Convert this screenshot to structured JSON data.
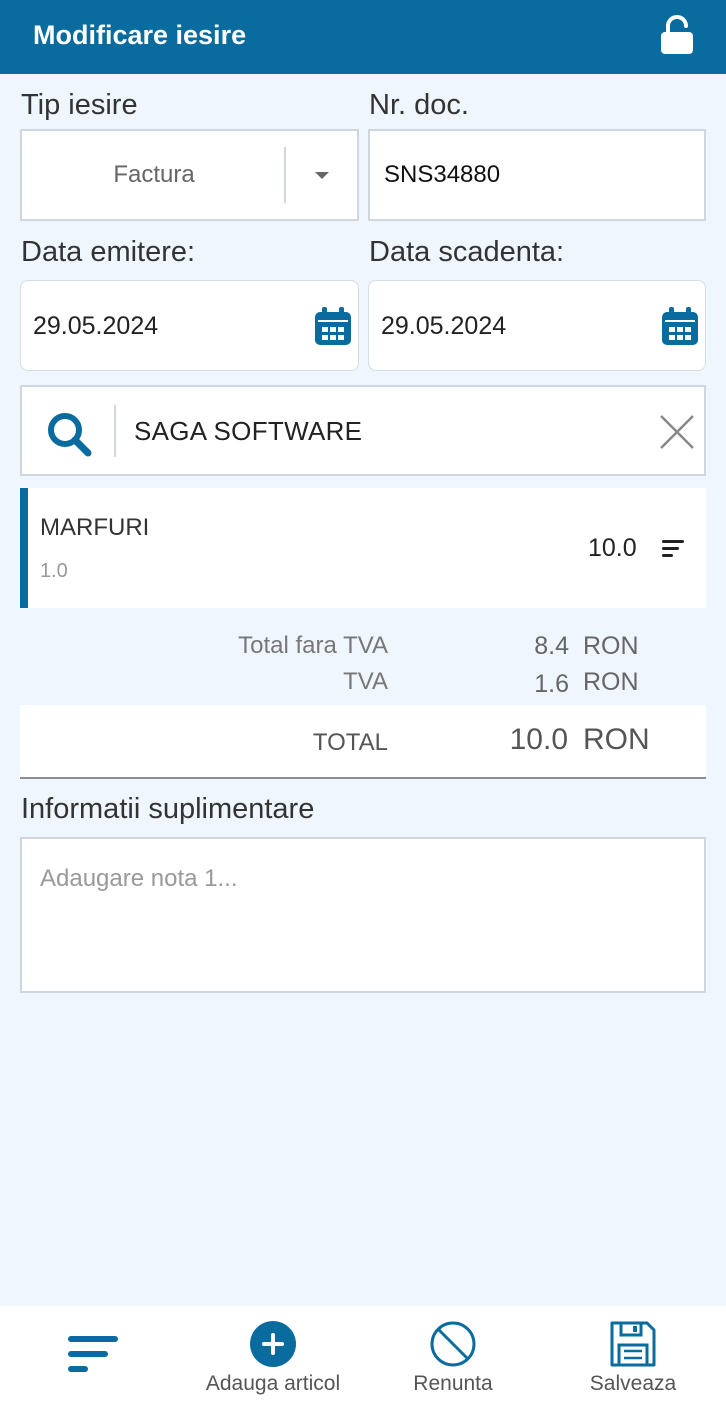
{
  "header": {
    "title": "Modificare iesire"
  },
  "form": {
    "tip_iesire_label": "Tip iesire",
    "tip_iesire_value": "Factura",
    "nr_doc_label": "Nr. doc.",
    "nr_doc_value": "SNS34880",
    "data_emitere_label": "Data emitere:",
    "data_emitere_value": "29.05.2024",
    "data_scadenta_label": "Data scadenta:",
    "data_scadenta_value": "29.05.2024",
    "partner_value": "SAGA SOFTWARE"
  },
  "items": [
    {
      "name": "MARFURI",
      "quantity": "1.0",
      "value": "10.0"
    }
  ],
  "summary": {
    "total_fara_tva_label": "Total fara TVA",
    "total_fara_tva_value": "8.4",
    "tva_label": "TVA",
    "tva_value": "1.6",
    "currency": "RON",
    "total_label": "TOTAL",
    "total_value": "10.0"
  },
  "notes": {
    "label": "Informatii suplimentare",
    "placeholder": "Adaugare nota 1..."
  },
  "bottom_bar": {
    "add_label": "Adauga articol",
    "cancel_label": "Renunta",
    "save_label": "Salveaza"
  },
  "colors": {
    "primary": "#0a6b9e",
    "background": "#eff6fd"
  }
}
